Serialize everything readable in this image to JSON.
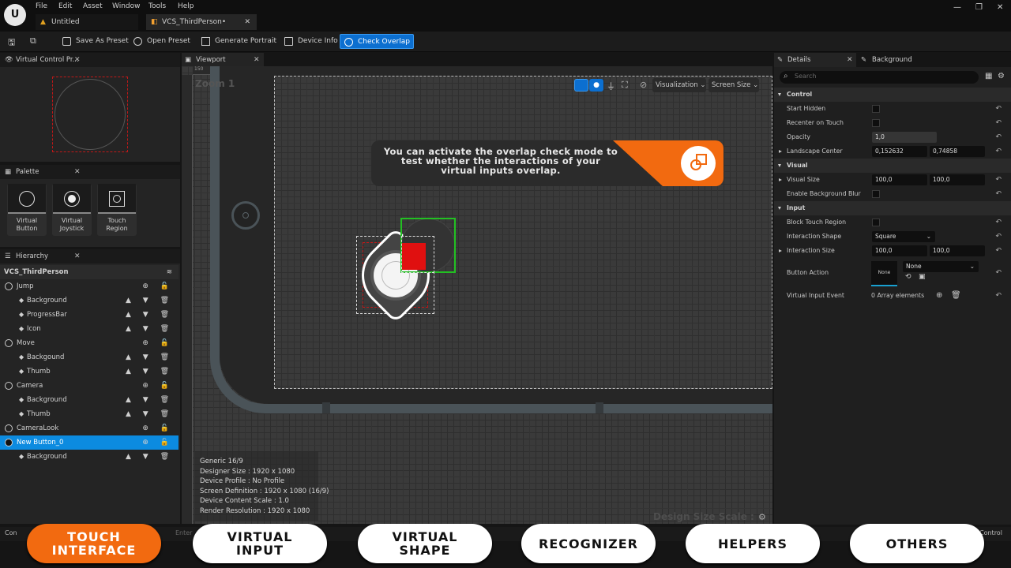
{
  "menu": [
    "File",
    "Edit",
    "Asset",
    "Window",
    "Tools",
    "Help"
  ],
  "tabs": [
    {
      "label": "Untitled"
    },
    {
      "label": "VCS_ThirdPerson•"
    }
  ],
  "toolbar": {
    "save_preset": "Save As Preset",
    "open_preset": "Open Preset",
    "generate_portrait": "Generate Portrait",
    "device_info": "Device Info",
    "check_overlap": "Check Overlap"
  },
  "panels": {
    "preview": "Virtual Control Pr...",
    "palette": "Palette",
    "hierarchy": "Hierarchy",
    "viewport": "Viewport",
    "details": "Details",
    "background_tab": "Background"
  },
  "palette_items": [
    {
      "label": "Virtual\nButton"
    },
    {
      "label": "Virtual\nJoystick"
    },
    {
      "label": "Touch\nRegion"
    }
  ],
  "hierarchy": {
    "root": "VCS_ThirdPerson",
    "rows": [
      {
        "label": "Jump",
        "kind": "group"
      },
      {
        "label": "Background",
        "kind": "child"
      },
      {
        "label": "ProgressBar",
        "kind": "child"
      },
      {
        "label": "Icon",
        "kind": "child"
      },
      {
        "label": "Move",
        "kind": "group"
      },
      {
        "label": "Backgound",
        "kind": "child"
      },
      {
        "label": "Thumb",
        "kind": "child"
      },
      {
        "label": "Camera",
        "kind": "group"
      },
      {
        "label": "Background",
        "kind": "child"
      },
      {
        "label": "Thumb",
        "kind": "child"
      },
      {
        "label": "CameraLook",
        "kind": "group"
      },
      {
        "label": "New Button_0",
        "kind": "group",
        "selected": true
      },
      {
        "label": "Background",
        "kind": "child"
      }
    ]
  },
  "viewport": {
    "zoom": "Zoom 1",
    "ruler_ticks": [
      "150",
      "100",
      "50",
      "0",
      "50",
      "100",
      "150",
      "200",
      "250",
      "300",
      "350",
      "400",
      "450",
      "500",
      "550",
      "600",
      "650",
      "700",
      "750",
      "800",
      "850",
      "900"
    ],
    "visualization": "Visualization",
    "screen_size": "Screen Size",
    "tooltip": "You can activate the overlap check mode to test whether the interactions of your virtual inputs overlap.",
    "design_scale": "Design Size Scale : 1,0",
    "info": [
      "Generic 16/9",
      "Designer Size : 1920 x 1080",
      "Device Profile : No Profile",
      "Screen Definition : 1920 x 1080 (16/9)",
      "Device Content Scale : 1.0",
      "Render Resolution : 1920 x 1080"
    ]
  },
  "details": {
    "search_placeholder": "Search",
    "sections": {
      "control": "Control",
      "visual": "Visual",
      "input": "Input"
    },
    "start_hidden": "Start Hidden",
    "recenter": "Recenter on Touch",
    "opacity": "Opacity",
    "opacity_val": "1,0",
    "landscape": "Landscape Center",
    "landscape_x": "0,152632",
    "landscape_y": "0,74858",
    "visual_size": "Visual Size",
    "vs_x": "100,0",
    "vs_y": "100,0",
    "blur": "Enable Background Blur",
    "block_touch": "Block Touch Region",
    "interaction_shape": "Interaction Shape",
    "shape_val": "Square",
    "interaction_size": "Interaction Size",
    "is_x": "100,0",
    "is_y": "100,0",
    "button_action": "Button Action",
    "action_none": "None",
    "action_select": "None",
    "event": "Virtual Input Event",
    "event_val": "0 Array elements"
  },
  "bottom": {
    "left": "Con",
    "filter": "Enter",
    "right": "Control"
  },
  "nav": [
    "TOUCH\nINTERFACE",
    "VIRTUAL\nINPUT",
    "VIRTUAL\nSHAPE",
    "RECOGNIZER",
    "HELPERS",
    "OTHERS"
  ],
  "colors": {
    "accent": "#0c8be0",
    "orange": "#f26a10",
    "overlap_red": "#e01010",
    "overlap_green": "#22c022"
  }
}
